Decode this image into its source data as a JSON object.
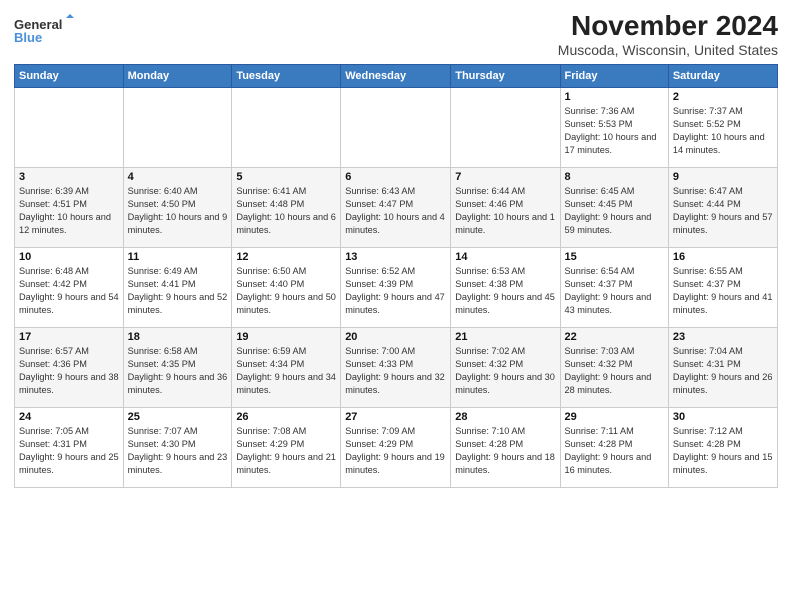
{
  "logo": {
    "line1": "General",
    "line2": "Blue"
  },
  "title": "November 2024",
  "subtitle": "Muscoda, Wisconsin, United States",
  "weekdays": [
    "Sunday",
    "Monday",
    "Tuesday",
    "Wednesday",
    "Thursday",
    "Friday",
    "Saturday"
  ],
  "weeks": [
    [
      {
        "day": "",
        "info": ""
      },
      {
        "day": "",
        "info": ""
      },
      {
        "day": "",
        "info": ""
      },
      {
        "day": "",
        "info": ""
      },
      {
        "day": "",
        "info": ""
      },
      {
        "day": "1",
        "info": "Sunrise: 7:36 AM\nSunset: 5:53 PM\nDaylight: 10 hours and 17 minutes."
      },
      {
        "day": "2",
        "info": "Sunrise: 7:37 AM\nSunset: 5:52 PM\nDaylight: 10 hours and 14 minutes."
      }
    ],
    [
      {
        "day": "3",
        "info": "Sunrise: 6:39 AM\nSunset: 4:51 PM\nDaylight: 10 hours and 12 minutes."
      },
      {
        "day": "4",
        "info": "Sunrise: 6:40 AM\nSunset: 4:50 PM\nDaylight: 10 hours and 9 minutes."
      },
      {
        "day": "5",
        "info": "Sunrise: 6:41 AM\nSunset: 4:48 PM\nDaylight: 10 hours and 6 minutes."
      },
      {
        "day": "6",
        "info": "Sunrise: 6:43 AM\nSunset: 4:47 PM\nDaylight: 10 hours and 4 minutes."
      },
      {
        "day": "7",
        "info": "Sunrise: 6:44 AM\nSunset: 4:46 PM\nDaylight: 10 hours and 1 minute."
      },
      {
        "day": "8",
        "info": "Sunrise: 6:45 AM\nSunset: 4:45 PM\nDaylight: 9 hours and 59 minutes."
      },
      {
        "day": "9",
        "info": "Sunrise: 6:47 AM\nSunset: 4:44 PM\nDaylight: 9 hours and 57 minutes."
      }
    ],
    [
      {
        "day": "10",
        "info": "Sunrise: 6:48 AM\nSunset: 4:42 PM\nDaylight: 9 hours and 54 minutes."
      },
      {
        "day": "11",
        "info": "Sunrise: 6:49 AM\nSunset: 4:41 PM\nDaylight: 9 hours and 52 minutes."
      },
      {
        "day": "12",
        "info": "Sunrise: 6:50 AM\nSunset: 4:40 PM\nDaylight: 9 hours and 50 minutes."
      },
      {
        "day": "13",
        "info": "Sunrise: 6:52 AM\nSunset: 4:39 PM\nDaylight: 9 hours and 47 minutes."
      },
      {
        "day": "14",
        "info": "Sunrise: 6:53 AM\nSunset: 4:38 PM\nDaylight: 9 hours and 45 minutes."
      },
      {
        "day": "15",
        "info": "Sunrise: 6:54 AM\nSunset: 4:37 PM\nDaylight: 9 hours and 43 minutes."
      },
      {
        "day": "16",
        "info": "Sunrise: 6:55 AM\nSunset: 4:37 PM\nDaylight: 9 hours and 41 minutes."
      }
    ],
    [
      {
        "day": "17",
        "info": "Sunrise: 6:57 AM\nSunset: 4:36 PM\nDaylight: 9 hours and 38 minutes."
      },
      {
        "day": "18",
        "info": "Sunrise: 6:58 AM\nSunset: 4:35 PM\nDaylight: 9 hours and 36 minutes."
      },
      {
        "day": "19",
        "info": "Sunrise: 6:59 AM\nSunset: 4:34 PM\nDaylight: 9 hours and 34 minutes."
      },
      {
        "day": "20",
        "info": "Sunrise: 7:00 AM\nSunset: 4:33 PM\nDaylight: 9 hours and 32 minutes."
      },
      {
        "day": "21",
        "info": "Sunrise: 7:02 AM\nSunset: 4:32 PM\nDaylight: 9 hours and 30 minutes."
      },
      {
        "day": "22",
        "info": "Sunrise: 7:03 AM\nSunset: 4:32 PM\nDaylight: 9 hours and 28 minutes."
      },
      {
        "day": "23",
        "info": "Sunrise: 7:04 AM\nSunset: 4:31 PM\nDaylight: 9 hours and 26 minutes."
      }
    ],
    [
      {
        "day": "24",
        "info": "Sunrise: 7:05 AM\nSunset: 4:31 PM\nDaylight: 9 hours and 25 minutes."
      },
      {
        "day": "25",
        "info": "Sunrise: 7:07 AM\nSunset: 4:30 PM\nDaylight: 9 hours and 23 minutes."
      },
      {
        "day": "26",
        "info": "Sunrise: 7:08 AM\nSunset: 4:29 PM\nDaylight: 9 hours and 21 minutes."
      },
      {
        "day": "27",
        "info": "Sunrise: 7:09 AM\nSunset: 4:29 PM\nDaylight: 9 hours and 19 minutes."
      },
      {
        "day": "28",
        "info": "Sunrise: 7:10 AM\nSunset: 4:28 PM\nDaylight: 9 hours and 18 minutes."
      },
      {
        "day": "29",
        "info": "Sunrise: 7:11 AM\nSunset: 4:28 PM\nDaylight: 9 hours and 16 minutes."
      },
      {
        "day": "30",
        "info": "Sunrise: 7:12 AM\nSunset: 4:28 PM\nDaylight: 9 hours and 15 minutes."
      }
    ]
  ]
}
